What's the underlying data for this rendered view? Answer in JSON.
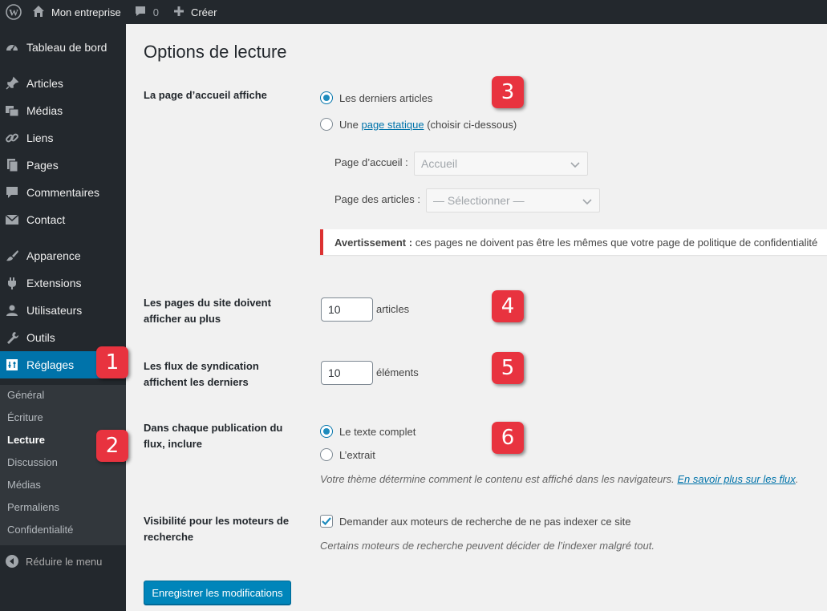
{
  "adminbar": {
    "site_name": "Mon entreprise",
    "comments_count": "0",
    "new_label": "Créer",
    "icons": [
      "wordpress-logo-icon",
      "home-icon",
      "comment-icon",
      "plus-icon"
    ]
  },
  "sidebar": {
    "items": [
      {
        "label": "Tableau de bord",
        "icon": "dashboard-icon"
      },
      {
        "label": "Articles",
        "icon": "pin-icon"
      },
      {
        "label": "Médias",
        "icon": "media-icon"
      },
      {
        "label": "Liens",
        "icon": "link-icon"
      },
      {
        "label": "Pages",
        "icon": "pages-icon"
      },
      {
        "label": "Commentaires",
        "icon": "comment-icon"
      },
      {
        "label": "Contact",
        "icon": "mail-icon"
      },
      {
        "label": "Apparence",
        "icon": "brush-icon"
      },
      {
        "label": "Extensions",
        "icon": "plugin-icon"
      },
      {
        "label": "Utilisateurs",
        "icon": "user-icon"
      },
      {
        "label": "Outils",
        "icon": "wrench-icon"
      },
      {
        "label": "Réglages",
        "icon": "settings-icon"
      }
    ],
    "submenu": [
      "Général",
      "Écriture",
      "Lecture",
      "Discussion",
      "Médias",
      "Permaliens",
      "Confidentialité"
    ],
    "collapse_label": "Réduire le menu"
  },
  "main": {
    "title": "Options de lecture",
    "front_page": {
      "label": "La page d’accueil affiche",
      "option_latest": "Les derniers articles",
      "option_static_prefix": "Une",
      "option_static_link": "page statique",
      "option_static_suffix": "(choisir ci-dessous)",
      "homepage_label": "Page d’accueil :",
      "homepage_value": "Accueil",
      "posts_page_label": "Page des articles :",
      "posts_page_value": "— Sélectionner —",
      "warning_bold": "Avertissement :",
      "warning_text": "ces pages ne doivent pas être les mêmes que votre page de politique de confidentialité"
    },
    "posts_per_page": {
      "label_line1": "Les pages du site doivent",
      "label_line2": "afficher au plus",
      "value": "10",
      "suffix": "articles"
    },
    "feed_items": {
      "label_line1": "Les flux de syndication",
      "label_line2": "affichent les derniers",
      "value": "10",
      "suffix": "éléments"
    },
    "feed_content": {
      "label_line1": "Dans chaque publication du",
      "label_line2": "flux, inclure",
      "option_full": "Le texte complet",
      "option_excerpt": "L’extrait",
      "description": "Votre thème détermine comment le contenu est affiché dans les navigateurs.",
      "description_link": "En savoir plus sur les flux",
      "description_end": "."
    },
    "visibility": {
      "label_line1": "Visibilité pour les moteurs de",
      "label_line2": "recherche",
      "checkbox_label": "Demander aux moteurs de recherche de ne pas indexer ce site",
      "description": "Certains moteurs de recherche peuvent décider de l’indexer malgré tout."
    },
    "submit_label": "Enregistrer les modifications"
  },
  "markers": [
    "1",
    "2",
    "3",
    "4",
    "5",
    "6"
  ],
  "colors": {
    "accent": "#0073aa",
    "sidebar": "#23282d",
    "warning": "#dc3232",
    "marker": "#e8333f"
  }
}
